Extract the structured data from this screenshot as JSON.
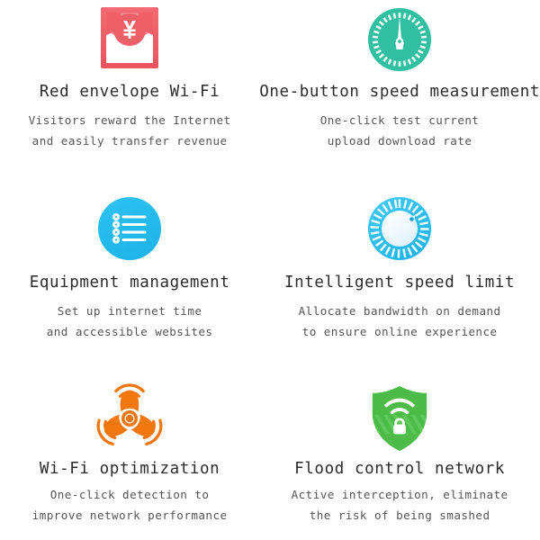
{
  "page": {
    "background": "#ffffff",
    "columns": 2,
    "rows": 3
  },
  "colors": {
    "red": "#ef5f67",
    "red_light": "#f58289",
    "teal": "#31bfa2",
    "blue": "#29bdf0",
    "blue_dark": "#1aa9e0",
    "orange": "#f2770f",
    "green": "#4cbb47",
    "green_dark": "#3da939",
    "title_text": "#2b2b2b",
    "desc_text": "#555555"
  },
  "features": [
    {
      "id": "red-envelope-wifi",
      "icon": "red-envelope-icon",
      "title": "Red envelope Wi-Fi",
      "desc_lines": [
        "Visitors reward the Internet",
        "and easily transfer revenue"
      ]
    },
    {
      "id": "one-button-speed-measurement",
      "icon": "speedometer-icon",
      "title": "One-button speed measurement",
      "desc_lines": [
        "One-click test current",
        "upload download rate"
      ]
    },
    {
      "id": "equipment-management",
      "icon": "list-circle-icon",
      "title": "Equipment management",
      "desc_lines": [
        "Set up internet time",
        "and accessible websites"
      ]
    },
    {
      "id": "intelligent-speed-limit",
      "icon": "dial-knob-icon",
      "title": "Intelligent speed limit",
      "desc_lines": [
        "Allocate bandwidth on demand",
        "to ensure online experience"
      ]
    },
    {
      "id": "wifi-optimization",
      "icon": "fan-blade-icon",
      "title": "Wi-Fi optimization",
      "desc_lines": [
        "One-click detection to",
        "improve network performance"
      ]
    },
    {
      "id": "flood-control-network",
      "icon": "shield-lock-wifi-icon",
      "title": "Flood control network",
      "desc_lines": [
        "Active interception, eliminate",
        "the risk of being smashed"
      ]
    }
  ]
}
